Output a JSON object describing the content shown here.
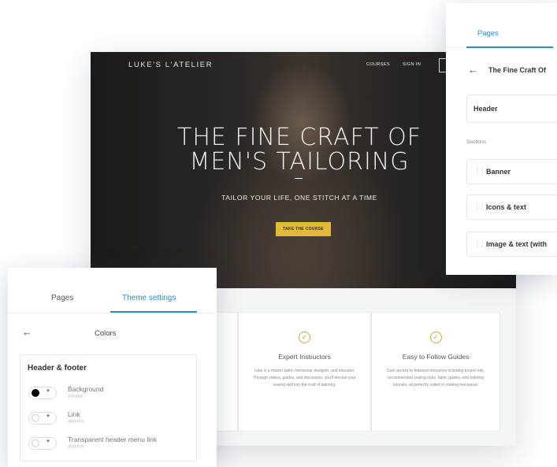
{
  "site": {
    "brand": "LUKE'S L'ATELIER",
    "nav": [
      "COURSES",
      "SIGN IN"
    ],
    "headline_line1": "THE FINE CRAFT OF",
    "headline_line2": "MEN'S TAILORING",
    "tagline": "TAILOR YOUR LIFE, ONE STITCH AT A TIME",
    "cta_label": "TAKE THE COURSE",
    "features": [
      {
        "title": "",
        "desc": ""
      },
      {
        "title": "Expert Instructors",
        "desc": "Luke is a master tailor, menswear designer, and educator. Through videos, guides, and discussion, you'll elevate your sewing skill into the craft of tailoring."
      },
      {
        "title": "Easy to Follow Guides",
        "desc": "Gain access to featured resources including project kits, recommended sewing tools, fabric guides, and tailoring tutorials, all perfectly suited to making menswear."
      }
    ]
  },
  "right_panel": {
    "tab_label": "Pages",
    "back_icon": "arrow-left-icon",
    "page_title": "The Fine Craft Of",
    "header_label": "Header",
    "sections_label": "Sections",
    "sections": [
      "Banner",
      "Icons & text",
      "Image & text (with"
    ]
  },
  "left_panel": {
    "tabs": [
      "Pages",
      "Theme settings"
    ],
    "active_tab": "Theme settings",
    "back_icon": "arrow-left-icon",
    "section_title": "Colors",
    "group_title": "Header & footer",
    "options": [
      {
        "name": "Background",
        "hex": "#000000",
        "swatch": "#000000"
      },
      {
        "name": "Link",
        "hex": "#FFFFFF",
        "swatch": "#ffffff"
      },
      {
        "name": "Transparent header menu link",
        "hex": "#FFFFFF",
        "swatch": "#ffffff"
      }
    ]
  },
  "colors": {
    "accent": "#2f8ad1",
    "cta": "#e3b93a",
    "check": "#c9a63a"
  }
}
